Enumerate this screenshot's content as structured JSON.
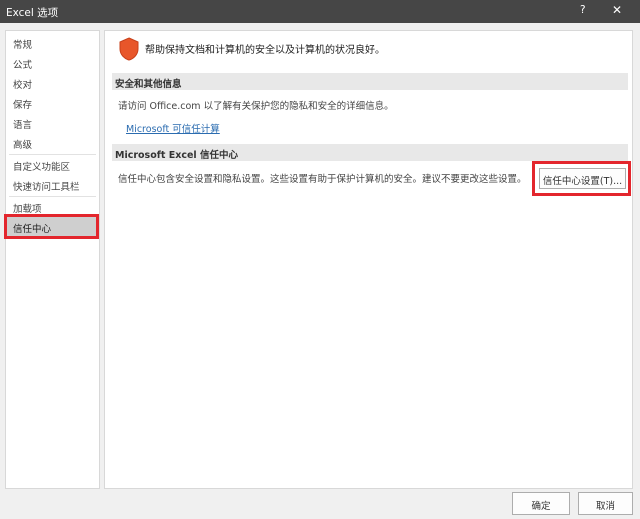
{
  "window": {
    "title": "Excel 选项",
    "help": "?",
    "close": "✕"
  },
  "sidebar": {
    "items": [
      {
        "label": "常规"
      },
      {
        "label": "公式"
      },
      {
        "label": "校对"
      },
      {
        "label": "保存"
      },
      {
        "label": "语言"
      },
      {
        "label": "高级"
      },
      {
        "label": "自定义功能区"
      },
      {
        "label": "快速访问工具栏"
      },
      {
        "label": "加载项"
      },
      {
        "label": "信任中心"
      }
    ],
    "selected": "信任中心"
  },
  "main": {
    "intro": "帮助保持文档和计算机的安全以及计算机的状况良好。",
    "section1": {
      "title": "安全和其他信息",
      "text": "请访问 Office.com 以了解有关保护您的隐私和安全的详细信息。",
      "link": "Microsoft 可信任计算"
    },
    "section2": {
      "title": "Microsoft Excel 信任中心",
      "text": "信任中心包含安全设置和隐私设置。这些设置有助于保护计算机的安全。建议不要更改这些设置。",
      "button": "信任中心设置(T)..."
    }
  },
  "footer": {
    "ok": "确定",
    "cancel": "取消"
  },
  "colors": {
    "highlight": "#e3262d",
    "shield": "#e8562a",
    "link": "#2b6cb0"
  }
}
